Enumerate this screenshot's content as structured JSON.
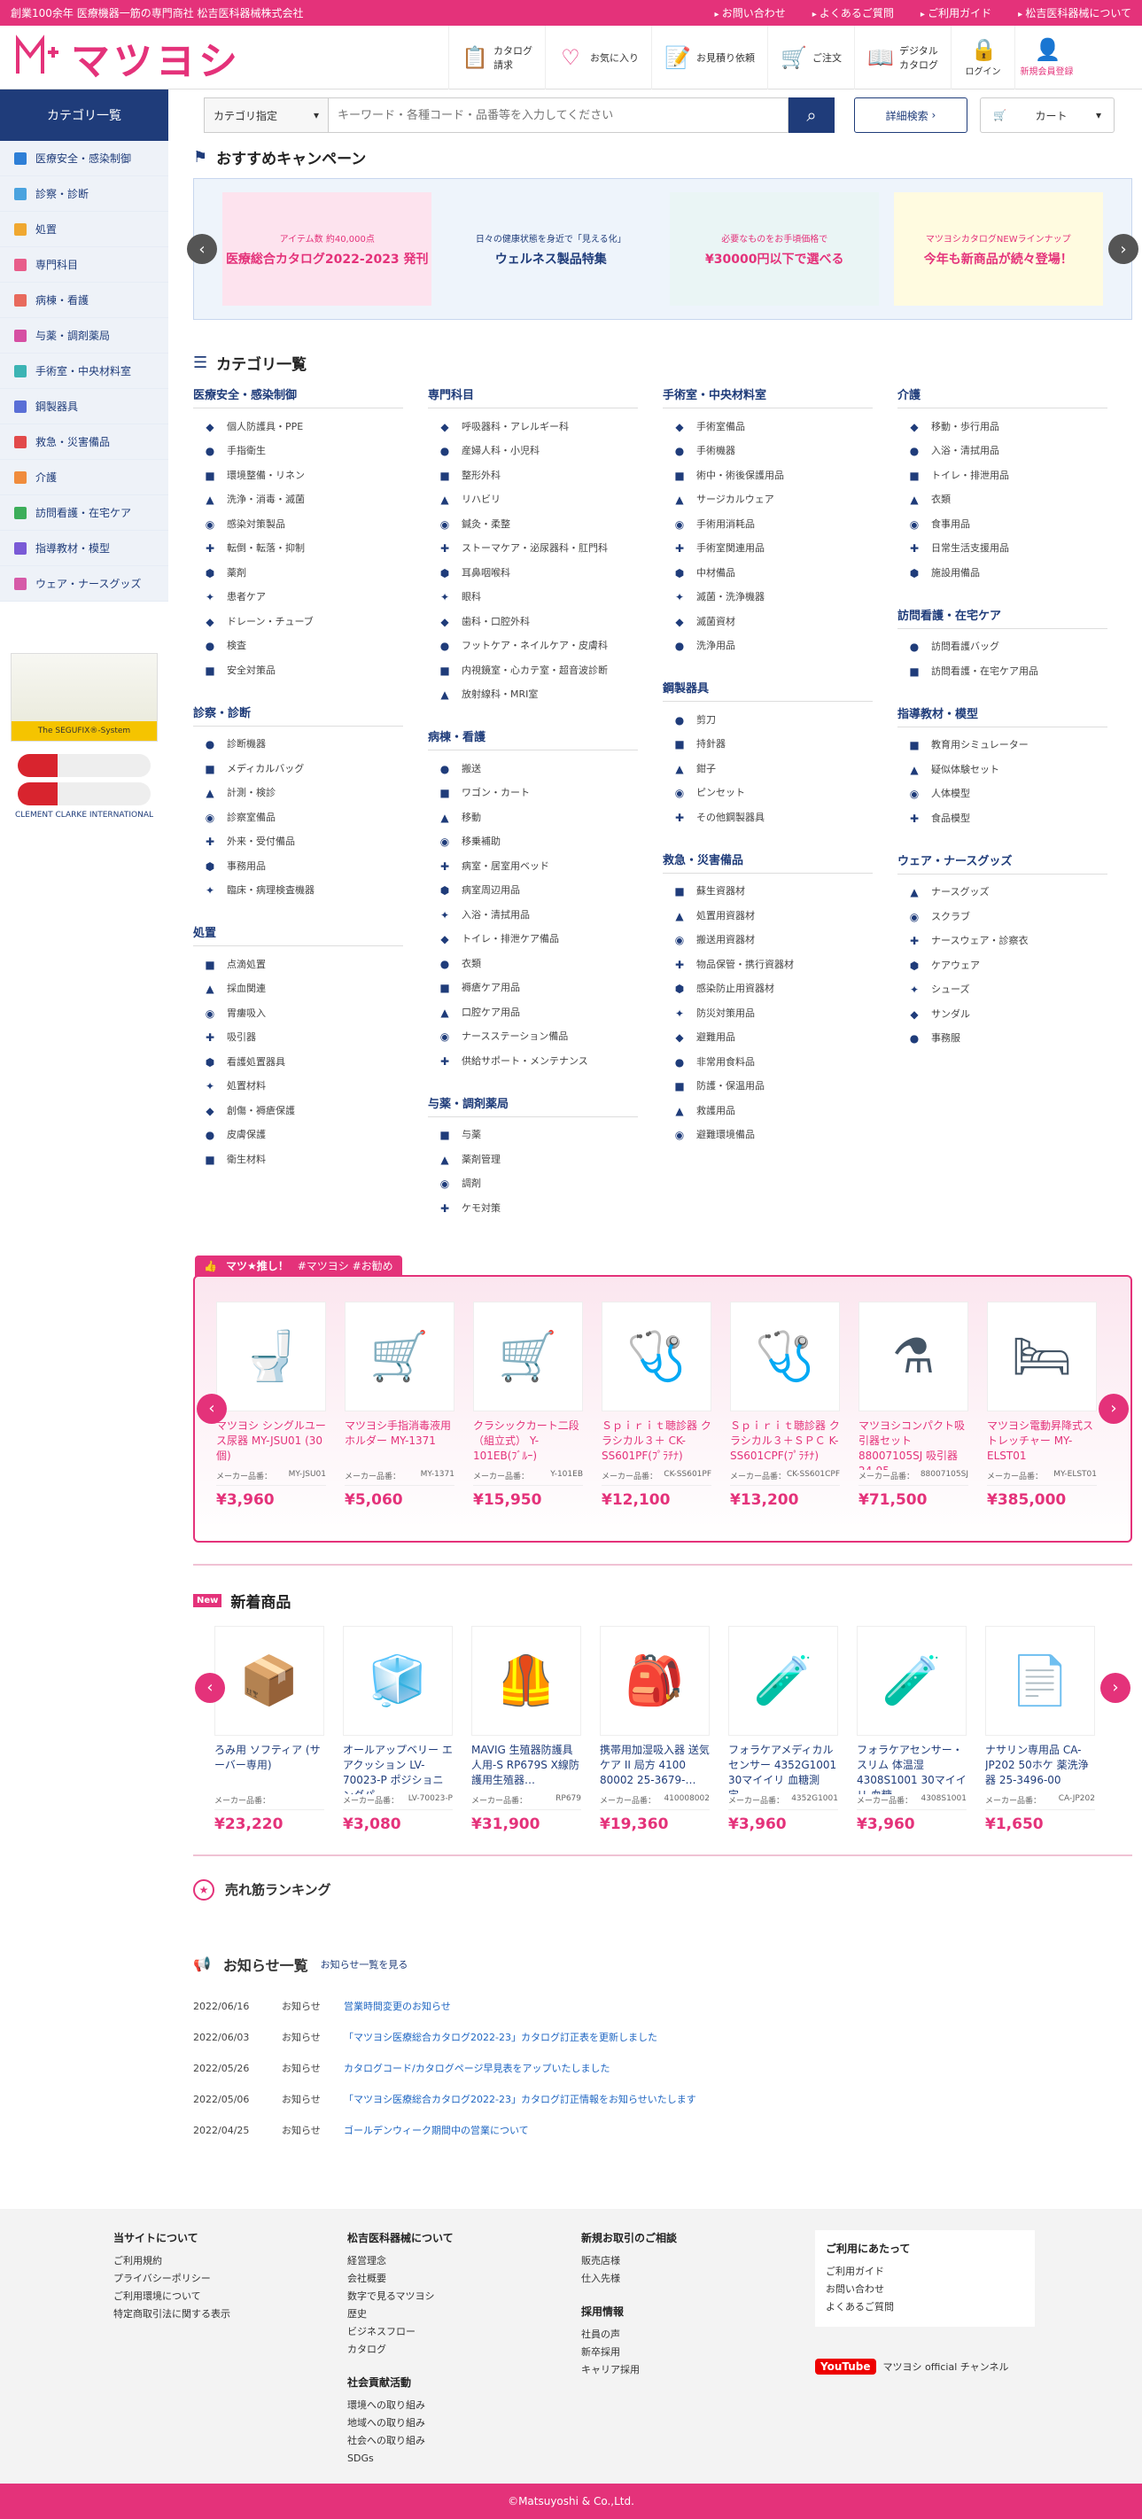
{
  "topbar": {
    "tagline": "創業100余年 医療機器一筋の専門商社 松吉医科器械株式会社",
    "links": [
      "お問い合わせ",
      "よくあるご質問",
      "ご利用ガイド",
      "松吉医科器械について"
    ]
  },
  "logo": {
    "name": "マツヨシ"
  },
  "header_nav": [
    {
      "label": "カタログ\n請求",
      "icon": "catalog-icon"
    },
    {
      "label": "お気に入り",
      "icon": "heart-icon"
    },
    {
      "label": "お見積り依頼",
      "icon": "quote-icon"
    },
    {
      "label": "ご注文",
      "icon": "cart-icon"
    },
    {
      "label": "デジタル\nカタログ",
      "icon": "book-icon"
    }
  ],
  "header_square": [
    {
      "label": "ログイン",
      "icon": "lock-icon"
    },
    {
      "label": "新規会員登録",
      "icon": "user-add-icon"
    }
  ],
  "search": {
    "category_head": "カテゴリ一覧",
    "select": "カテゴリ指定",
    "placeholder": "キーワード・各種コード・品番等を入力してください",
    "detail": "詳細検索",
    "cart": "カート"
  },
  "sidebar": {
    "items": [
      {
        "label": "医療安全・感染制御",
        "color": "#2e7fd6"
      },
      {
        "label": "診察・診断",
        "color": "#4aa3df"
      },
      {
        "label": "処置",
        "color": "#f0a830"
      },
      {
        "label": "専門科目",
        "color": "#e85d8a"
      },
      {
        "label": "病棟・看護",
        "color": "#e86a5d"
      },
      {
        "label": "与薬・調剤薬局",
        "color": "#d64fa3"
      },
      {
        "label": "手術室・中央材料室",
        "color": "#3cb4b4"
      },
      {
        "label": "鋼製器具",
        "color": "#5a6fd6"
      },
      {
        "label": "救急・災害備品",
        "color": "#e24a4a"
      },
      {
        "label": "介護",
        "color": "#f08c3c"
      },
      {
        "label": "訪問看護・在宅ケア",
        "color": "#3cae5a"
      },
      {
        "label": "指導教材・模型",
        "color": "#7a5ad6"
      },
      {
        "label": "ウェア・ナースグッズ",
        "color": "#d65aa8"
      }
    ],
    "banner1": "The SEGUFIX®-System",
    "banner2": "CLEMENT CLARKE INTERNATIONAL"
  },
  "campaign": {
    "title": "おすすめキャンペーン",
    "banners": [
      {
        "text": "医療総合カタログ2022-2023 発刊",
        "sub": "アイテム数 約40,000点",
        "bg": "#fde3ee",
        "fg": "#e4327a"
      },
      {
        "text": "ウェルネス製品特集",
        "sub": "日々の健康状態を身近で「見える化」",
        "bg": "#eef4fb",
        "fg": "#1f3c7a"
      },
      {
        "text": "¥30000円以下で選べる",
        "sub": "必要なものをお手頃価格で",
        "bg": "#eaf5f5",
        "fg": "#e4327a"
      },
      {
        "text": "今年も新商品が続々登場！",
        "sub": "マツヨシカタログNEWラインナップ",
        "bg": "#fffbe0",
        "fg": "#e4327a"
      }
    ]
  },
  "categories": {
    "title": "カテゴリ一覧",
    "columns": [
      [
        {
          "h": "医療安全・感染制御",
          "items": [
            "個人防護具・PPE",
            "手指衛生",
            "環境整備・リネン",
            "洗浄・消毒・滅菌",
            "感染対策製品",
            "転倒・転落・抑制",
            "薬剤",
            "患者ケア",
            "ドレーン・チューブ",
            "検査",
            "安全対策品"
          ]
        },
        {
          "h": "診察・診断",
          "items": [
            "診断機器",
            "メディカルバッグ",
            "計測・検診",
            "診察室備品",
            "外来・受付備品",
            "事務用品",
            "臨床・病理検査機器"
          ]
        },
        {
          "h": "処置",
          "items": [
            "点滴処置",
            "採血関連",
            "胃瘻吸入",
            "吸引器",
            "看護処置器具",
            "処置材料",
            "創傷・褥瘡保護",
            "皮膚保護",
            "衛生材料"
          ]
        }
      ],
      [
        {
          "h": "専門科目",
          "items": [
            "呼吸器科・アレルギー科",
            "産婦人科・小児科",
            "整形外科",
            "リハビリ",
            "鍼灸・柔整",
            "ストーマケア・泌尿器科・肛門科",
            "耳鼻咽喉科",
            "眼科",
            "歯科・口腔外科",
            "フットケア・ネイルケア・皮膚科",
            "内視鏡室・心カテ室・超音波診断",
            "放射線科・MRI室"
          ]
        },
        {
          "h": "病棟・看護",
          "items": [
            "搬送",
            "ワゴン・カート",
            "移動",
            "移乗補助",
            "病室・居室用ベッド",
            "病室周辺用品",
            "入浴・清拭用品",
            "トイレ・排泄ケア備品",
            "衣類",
            "褥瘡ケア用品",
            "口腔ケア用品",
            "ナースステーション備品",
            "供給サポート・メンテナンス"
          ]
        },
        {
          "h": "与薬・調剤薬局",
          "items": [
            "与薬",
            "薬剤管理",
            "調剤",
            "ケモ対策"
          ]
        }
      ],
      [
        {
          "h": "手術室・中央材料室",
          "items": [
            "手術室備品",
            "手術機器",
            "術中・術後保護用品",
            "サージカルウェア",
            "手術用消耗品",
            "手術室関連用品",
            "中材備品",
            "滅菌・洗浄機器",
            "滅菌資材",
            "洗浄用品"
          ]
        },
        {
          "h": "鋼製器具",
          "items": [
            "剪刀",
            "持針器",
            "鉗子",
            "ピンセット",
            "その他鋼製器具"
          ]
        },
        {
          "h": "救急・災害備品",
          "items": [
            "蘇生資器材",
            "処置用資器材",
            "搬送用資器材",
            "物品保管・携行資器材",
            "感染防止用資器材",
            "防災対策用品",
            "避難用品",
            "非常用食料品",
            "防護・保温用品",
            "救護用品",
            "避難環境備品"
          ]
        }
      ],
      [
        {
          "h": "介護",
          "items": [
            "移動・歩行用品",
            "入浴・清拭用品",
            "トイレ・排泄用品",
            "衣類",
            "食事用品",
            "日常生活支援用品",
            "施設用備品"
          ]
        },
        {
          "h": "訪問看護・在宅ケア",
          "items": [
            "訪問看護バッグ",
            "訪問看護・在宅ケア用品"
          ]
        },
        {
          "h": "指導教材・模型",
          "items": [
            "教育用シミュレーター",
            "疑似体験セット",
            "人体模型",
            "食品模型"
          ]
        },
        {
          "h": "ウェア・ナースグッズ",
          "items": [
            "ナースグッズ",
            "スクラブ",
            "ナースウェア・診察衣",
            "ケアウェア",
            "シューズ",
            "サンダル",
            "事務服"
          ]
        }
      ]
    ]
  },
  "recommend": {
    "tab": "マツ★推し！",
    "tags": "#マツヨシ #お勧め",
    "products": [
      {
        "name": "マツヨシ シングルユース尿器 MY-JSU01 (30個)",
        "code": "MY-JSU01",
        "price": "¥3,960",
        "icon": "🚽"
      },
      {
        "name": "マツヨシ手指消毒液用ホルダー MY-1371",
        "code": "MY-1371",
        "price": "¥5,060",
        "icon": "🛒"
      },
      {
        "name": "クラシックカート二段（組立式） Y-101EB(ﾌﾞﾙｰ)",
        "code": "Y-101EB",
        "price": "¥15,950",
        "icon": "🛒"
      },
      {
        "name": "Ｓｐｉｒｉｔ聴診器 クラシカル３＋ CK-SS601PF(ﾌﾟﾗﾁﾅ)",
        "code": "CK-SS601PF",
        "price": "¥12,100",
        "icon": "🩺"
      },
      {
        "name": "Ｓｐｉｒｉｔ聴診器 クラシカル３＋ＳＰＣ K-SS601CPF(ﾌﾟﾗﾁﾅ)",
        "code": "CK-SS601CPF",
        "price": "¥13,200",
        "icon": "🩺"
      },
      {
        "name": "マツヨシコンパクト吸引器セット 88007105SJ 吸引器 24-95…",
        "code": "88007105SJ",
        "price": "¥71,500",
        "icon": "⚗"
      },
      {
        "name": "マツヨシ電動昇降式ストレッチャー MY-ELST01",
        "code": "MY-ELST01",
        "price": "¥385,000",
        "icon": "🛏"
      }
    ]
  },
  "new_items": {
    "title": "新着商品",
    "badge": "New",
    "products": [
      {
        "name": "ろみ用 ソフティア (サーバー専用)",
        "code": "",
        "price": "¥23,220",
        "icon": "📦"
      },
      {
        "name": "オールアップベリー エアクッション LV-70023-P ポジショニングパ…",
        "code": "LV-70023-P",
        "price": "¥3,080",
        "icon": "🧊"
      },
      {
        "name": "MAVIG 生殖器防護具 人用-S RP679S X線防護用生殖器…",
        "code": "RP679",
        "price": "¥31,900",
        "icon": "🦺"
      },
      {
        "name": "携帯用加湿吸入器 送気ケア II 局方 4100 80002 25-3679-…",
        "code": "410008002",
        "price": "¥19,360",
        "icon": "🎒"
      },
      {
        "name": "フォラケアメディカルセンサー 4352G1001 30マイイリ 血糖測定…",
        "code": "4352G1001",
        "price": "¥3,960",
        "icon": "🧪"
      },
      {
        "name": "フォラケアセンサー・スリム 体温湿 4308S1001 30マイイリ 血糖…",
        "code": "4308S1001",
        "price": "¥3,960",
        "icon": "🧪"
      },
      {
        "name": "ナサリン専用品 CA-JP202 50ホケ 薬洗浄器 25-3496-00",
        "code": "CA-JP202",
        "price": "¥1,650",
        "icon": "📄"
      }
    ]
  },
  "ranking": {
    "title": "売れ筋ランキング"
  },
  "news": {
    "title": "お知らせ一覧",
    "more": "お知らせ一覧を見る",
    "items": [
      {
        "date": "2022/06/16",
        "cat": "お知らせ",
        "text": "営業時間変更のお知らせ"
      },
      {
        "date": "2022/06/03",
        "cat": "お知らせ",
        "text": "「マツヨシ医療総合カタログ2022-23」カタログ訂正表を更新しました"
      },
      {
        "date": "2022/05/26",
        "cat": "お知らせ",
        "text": "カタログコード/カタログページ早見表をアップいたしました"
      },
      {
        "date": "2022/05/06",
        "cat": "お知らせ",
        "text": "「マツヨシ医療総合カタログ2022-23」カタログ訂正情報をお知らせいたします"
      },
      {
        "date": "2022/04/25",
        "cat": "お知らせ",
        "text": "ゴールデンウィーク期間中の営業について"
      }
    ]
  },
  "footer": {
    "col1": {
      "h": "当サイトについて",
      "items": [
        "ご利用規約",
        "プライバシーポリシー",
        "ご利用環境について",
        "特定商取引法に関する表示"
      ]
    },
    "col2": {
      "h": "松吉医科器械について",
      "items": [
        "経営理念",
        "会社概要",
        "数字で見るマツヨシ",
        "歴史",
        "ビジネスフロー",
        "カタログ"
      ],
      "h2": "社会貢献活動",
      "items2": [
        "環境への取り組み",
        "地域への取り組み",
        "社会への取り組み",
        "SDGs"
      ]
    },
    "col3": {
      "h": "新規お取引のご相談",
      "items": [
        "販売店様",
        "仕入先様"
      ],
      "h2": "採用情報",
      "items2": [
        "社員の声",
        "新卒採用",
        "キャリア採用"
      ]
    },
    "col4": {
      "h": "ご利用にあたって",
      "items": [
        "ご利用ガイド",
        "お問い合わせ",
        "よくあるご質問"
      ],
      "yt": "YouTube",
      "yt_text": "マツヨシ official チャンネル"
    }
  },
  "copyright": "©Matsuyoshi & Co.,Ltd."
}
